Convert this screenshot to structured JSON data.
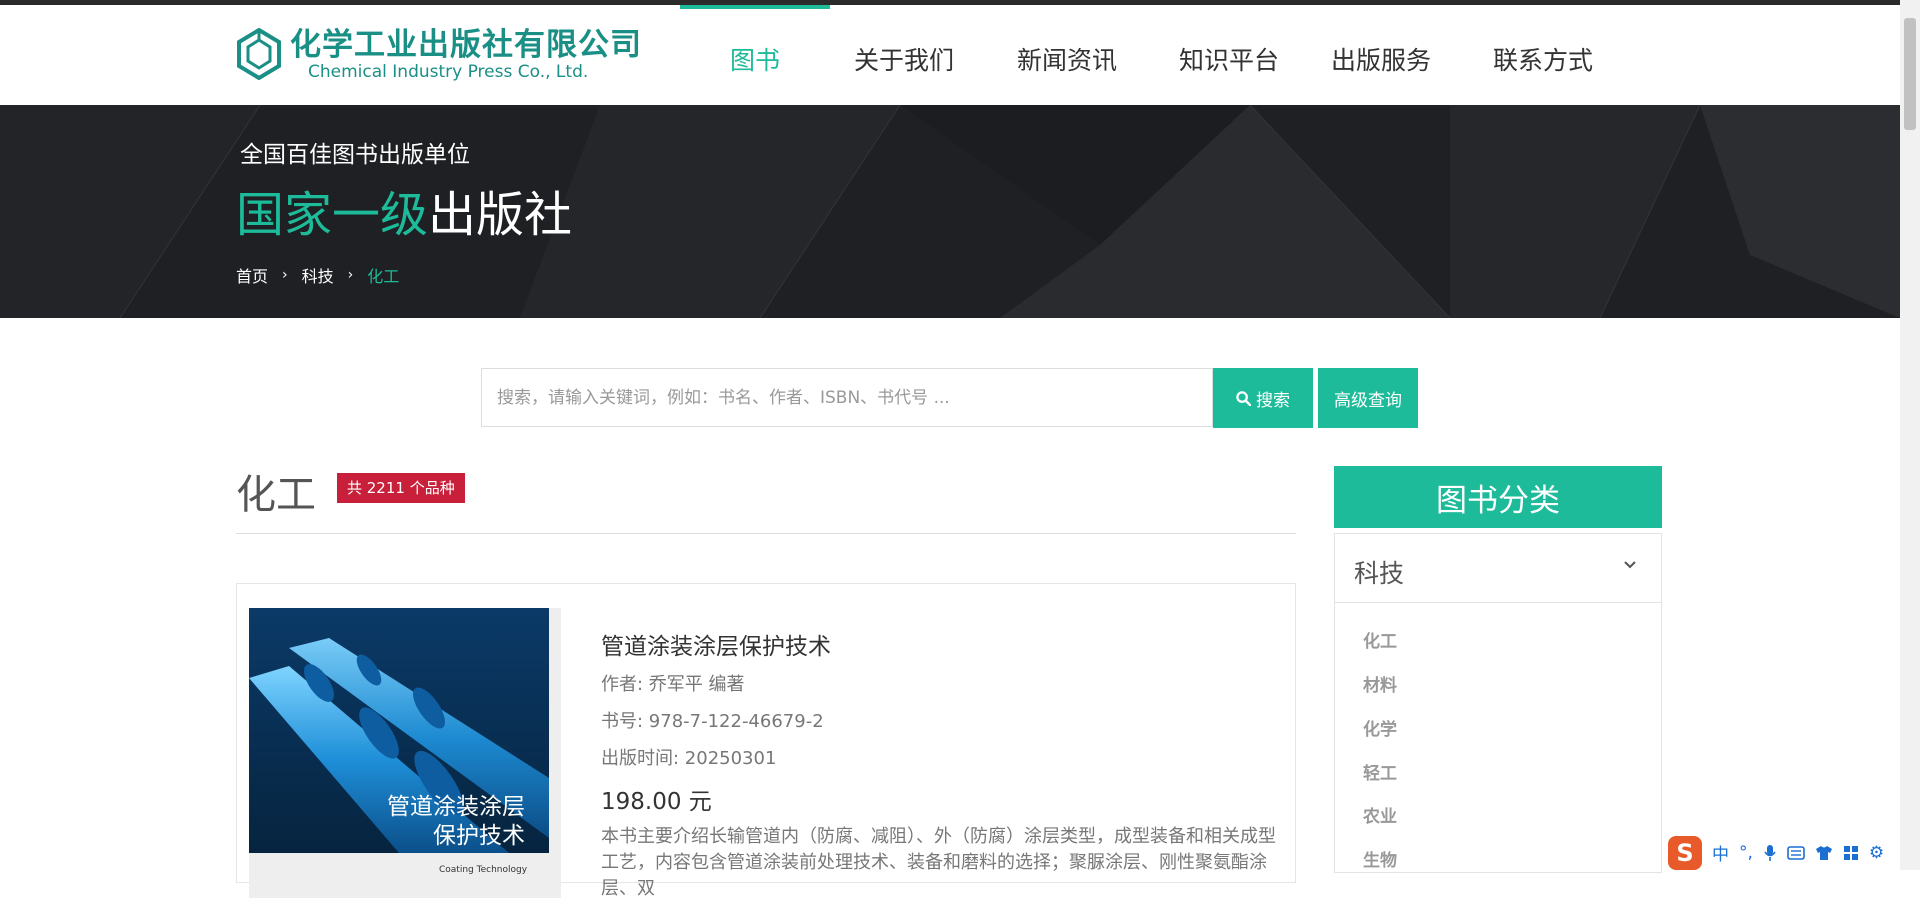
{
  "header": {
    "logo_cn": "化学工业出版社有限公司",
    "logo_en": "Chemical  Industry Press Co., Ltd.",
    "nav": [
      "图书",
      "关于我们",
      "新闻资讯",
      "知识平台",
      "出版服务",
      "联系方式"
    ],
    "active_nav": "图书"
  },
  "banner": {
    "tagline": "全国百佳图书出版单位",
    "headline_highlight": "国家一级",
    "headline_rest": "出版社",
    "breadcrumb": [
      "首页",
      "科技",
      "化工"
    ]
  },
  "search": {
    "placeholder": "搜索，请输入关键词，例如：书名、作者、ISBN、书代号 ...",
    "search_label": "搜索",
    "advanced_label": "高级查询"
  },
  "section": {
    "title": "化工",
    "count_badge": "共 2211 个品种"
  },
  "book": {
    "title": "管道涂装涂层保护技术",
    "author": "作者: 乔军平 编著",
    "isbn": "书号: 978-7-122-46679-2",
    "pub_date": "出版时间: 20250301",
    "price": "198.00 元",
    "description": "本书主要介绍长输管道内（防腐、减阻）、外（防腐）涂层类型，成型装备和相关成型工艺，内容包含管道涂装前处理技术、装备和磨料的选择；聚脲涂层、刚性聚氨酯涂层、双",
    "cover_title_line1": "管道涂装涂层",
    "cover_title_line2": "保护技术",
    "cover_subtitle": "Coating Technology"
  },
  "sidebar": {
    "heading": "图书分类",
    "group_label": "科技",
    "items": [
      "化工",
      "材料",
      "化学",
      "轻工",
      "农业",
      "生物"
    ]
  },
  "ime": {
    "logo": "S",
    "mode": "中"
  },
  "colors": {
    "accent": "#1dbb9a",
    "badge": "#c8203a",
    "banner_bg": "#1f2024"
  }
}
